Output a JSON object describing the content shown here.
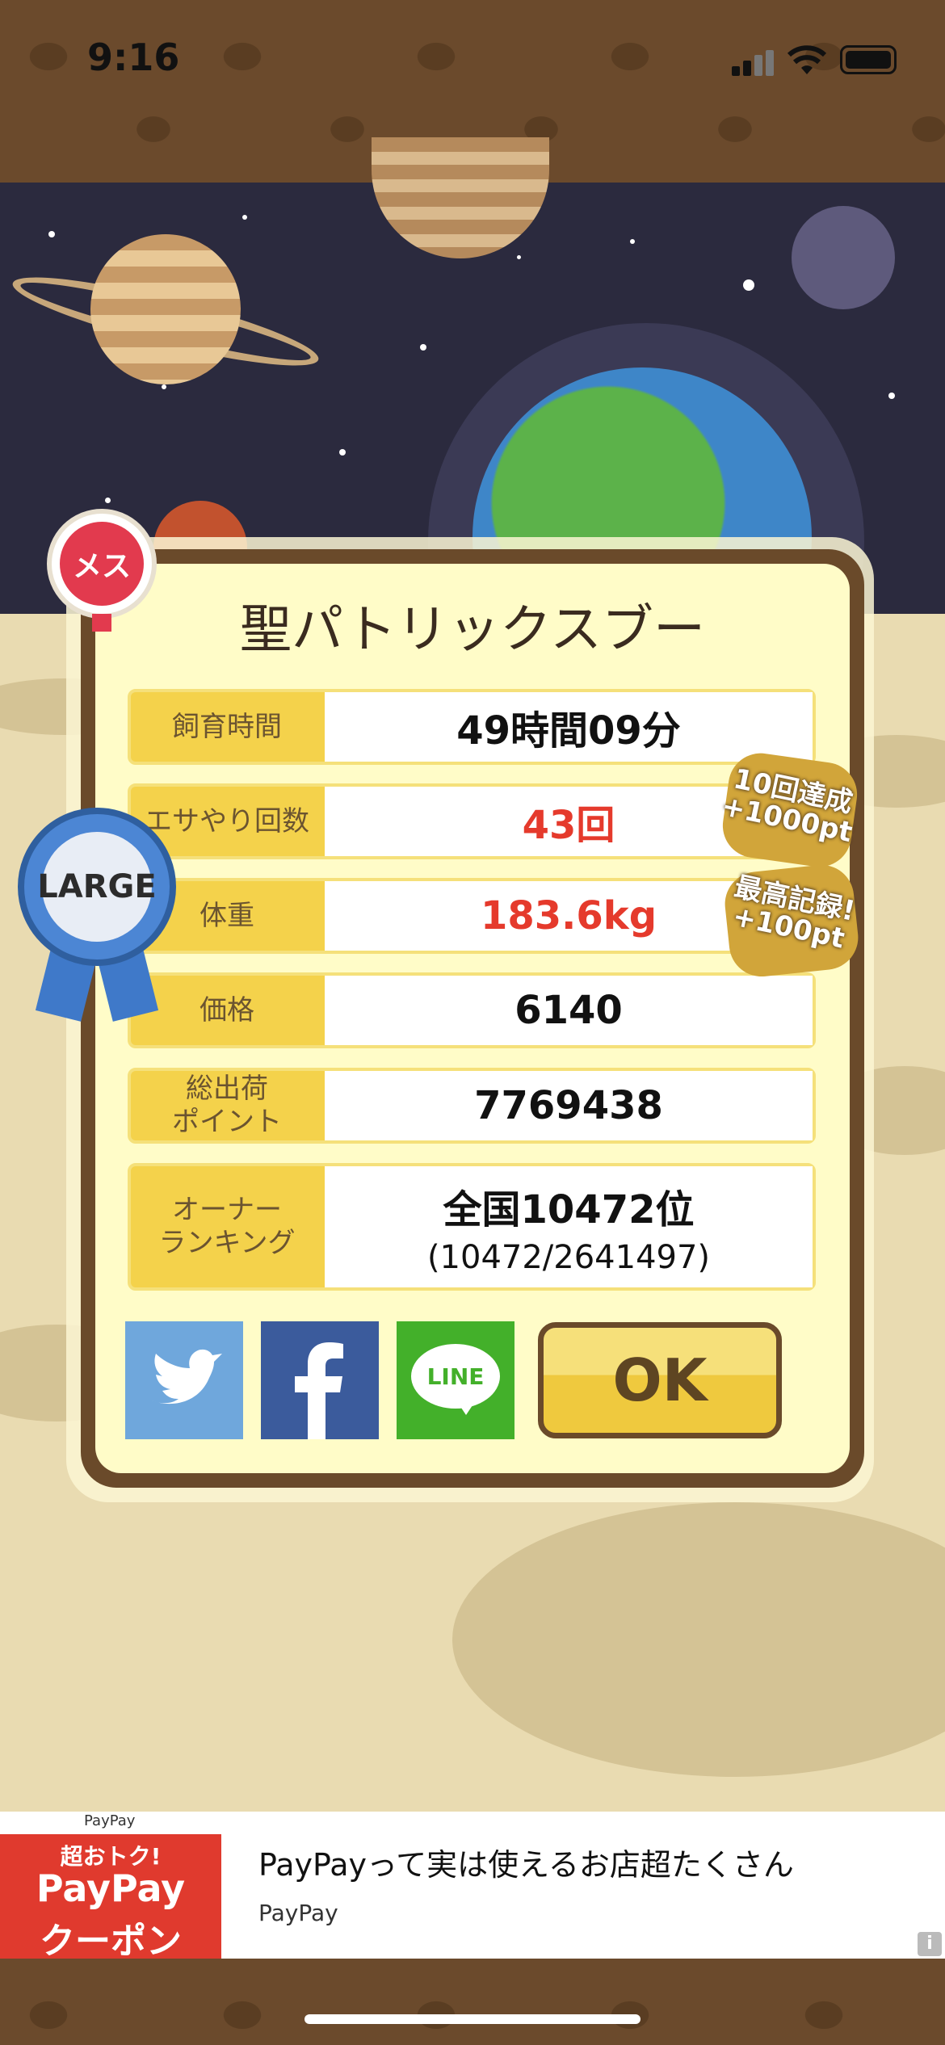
{
  "status_bar": {
    "time": "9:16"
  },
  "card": {
    "gender_label": "メス",
    "size_badge": "LARGE",
    "pet_name": "聖パトリックスブー",
    "rows": [
      {
        "label": "飼育時間",
        "value": "49時間09分"
      },
      {
        "label": "エサやり回数",
        "value": "43回"
      },
      {
        "label": "体重",
        "value": "183.6kg"
      },
      {
        "label": "価格",
        "value": "6140"
      },
      {
        "label": "総出荷\nポイント",
        "value": "7769438"
      },
      {
        "label": "オーナー\nランキング",
        "value": "全国10472位",
        "sub_value": "(10472/2641497)"
      }
    ],
    "achievement_badges": [
      "10回達成\n+1000pt",
      "最高記録!\n+100pt"
    ],
    "share": {
      "line_label": "LINE"
    },
    "ok_label": "OK"
  },
  "ad": {
    "brand_small": "PayPay",
    "image_lines": [
      "超おトク!",
      "PayPay",
      "クーポン"
    ],
    "title": "PayPayって実は使えるお店超たくさん",
    "advertiser": "PayPay",
    "info_icon": "i"
  },
  "colors": {
    "accent_red": "#e53a2c",
    "label_yellow": "#f4d24b",
    "twitter": "#6fa7dc",
    "facebook": "#3b5b9c",
    "line": "#43b02a"
  }
}
